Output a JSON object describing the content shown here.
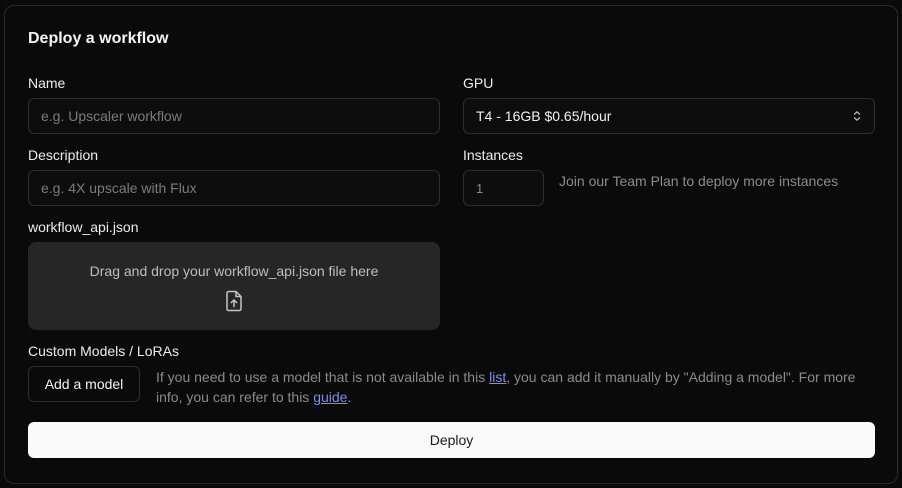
{
  "dialog": {
    "title": "Deploy a workflow"
  },
  "name": {
    "label": "Name",
    "placeholder": "e.g. Upscaler workflow"
  },
  "description": {
    "label": "Description",
    "placeholder": "e.g. 4X upscale with Flux"
  },
  "gpu": {
    "label": "GPU",
    "selected": "T4 - 16GB $0.65/hour"
  },
  "instances": {
    "label": "Instances",
    "value": "1",
    "hint": "Join our Team Plan to deploy more instances"
  },
  "workflow_file": {
    "label": "workflow_api.json",
    "dropzone_text": "Drag and drop your workflow_api.json file here",
    "icon": "file-upload-icon"
  },
  "custom_models": {
    "label": "Custom Models / LoRAs",
    "add_button": "Add a model",
    "info_part1": "If you need to use a model that is not available in this ",
    "info_link1": "list",
    "info_part2": ", you can add it manually by \"Adding a model\". For more info, you can refer to this ",
    "info_link2": "guide",
    "info_part3": "."
  },
  "deploy_button": "Deploy",
  "colors": {
    "background": "#0a0a0a",
    "border": "#2d2d2d",
    "dropzone": "#262626",
    "link": "#7d8cf5",
    "primary_button": "#fafafa"
  }
}
